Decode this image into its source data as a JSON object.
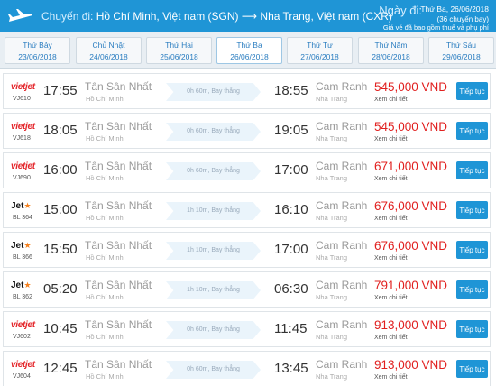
{
  "header": {
    "route_label": "Chuyến đi:",
    "route": "Hồ Chí Minh, Việt nam (SGN) ⟶ Nha Trang, Việt nam (CXR)",
    "date_label": "Ngày đi:",
    "date_text": "Thứ Ba, 26/06/2018",
    "flight_count": "(36 chuyến bay)",
    "price_note": "Giá vé đã bao gồm thuế và phụ phí"
  },
  "tabs": [
    {
      "day": "Thứ Bảy",
      "date": "23/06/2018"
    },
    {
      "day": "Chủ Nhật",
      "date": "24/06/2018"
    },
    {
      "day": "Thứ Hai",
      "date": "25/06/2018"
    },
    {
      "day": "Thứ Ba",
      "date": "26/06/2018"
    },
    {
      "day": "Thứ Tư",
      "date": "27/06/2018"
    },
    {
      "day": "Thứ Năm",
      "date": "28/06/2018"
    },
    {
      "day": "Thứ Sáu",
      "date": "29/06/2018"
    }
  ],
  "active_tab": "Thứ Ba",
  "flights": [
    {
      "airline": "vietjet",
      "logo_text": "vietjet",
      "flight_no": "VJ610",
      "dep_time": "17:55",
      "dep_airport": "Tân Sân Nhất",
      "dep_city": "Hồ Chí Minh",
      "duration": "0h 60m, Bay thẳng",
      "arr_time": "18:55",
      "arr_airport": "Cam Ranh",
      "arr_city": "Nha Trang",
      "price": "545,000 VND",
      "detail": "Xem chi tiết",
      "button": "Tiếp tục"
    },
    {
      "airline": "vietjet",
      "logo_text": "vietjet",
      "flight_no": "VJ618",
      "dep_time": "18:05",
      "dep_airport": "Tân Sân Nhất",
      "dep_city": "Hồ Chí Minh",
      "duration": "0h 60m, Bay thẳng",
      "arr_time": "19:05",
      "arr_airport": "Cam Ranh",
      "arr_city": "Nha Trang",
      "price": "545,000 VND",
      "detail": "Xem chi tiết",
      "button": "Tiếp tục"
    },
    {
      "airline": "vietjet",
      "logo_text": "vietjet",
      "flight_no": "VJ690",
      "dep_time": "16:00",
      "dep_airport": "Tân Sân Nhất",
      "dep_city": "Hồ Chí Minh",
      "duration": "0h 60m, Bay thẳng",
      "arr_time": "17:00",
      "arr_airport": "Cam Ranh",
      "arr_city": "Nha Trang",
      "price": "671,000 VND",
      "detail": "Xem chi tiết",
      "button": "Tiếp tục"
    },
    {
      "airline": "jetstar",
      "logo_text": "Jet",
      "flight_no": "BL 364",
      "dep_time": "15:00",
      "dep_airport": "Tân Sân Nhất",
      "dep_city": "Hồ Chí Minh",
      "duration": "1h 10m, Bay thẳng",
      "arr_time": "16:10",
      "arr_airport": "Cam Ranh",
      "arr_city": "Nha Trang",
      "price": "676,000 VND",
      "detail": "Xem chi tiết",
      "button": "Tiếp tục"
    },
    {
      "airline": "jetstar",
      "logo_text": "Jet",
      "flight_no": "BL 366",
      "dep_time": "15:50",
      "dep_airport": "Tân Sân Nhất",
      "dep_city": "Hồ Chí Minh",
      "duration": "1h 10m, Bay thẳng",
      "arr_time": "17:00",
      "arr_airport": "Cam Ranh",
      "arr_city": "Nha Trang",
      "price": "676,000 VND",
      "detail": "Xem chi tiết",
      "button": "Tiếp tục"
    },
    {
      "airline": "jetstar",
      "logo_text": "Jet",
      "flight_no": "BL 362",
      "dep_time": "05:20",
      "dep_airport": "Tân Sân Nhất",
      "dep_city": "Hồ Chí Minh",
      "duration": "1h 10m, Bay thẳng",
      "arr_time": "06:30",
      "arr_airport": "Cam Ranh",
      "arr_city": "Nha Trang",
      "price": "791,000 VND",
      "detail": "Xem chi tiết",
      "button": "Tiếp tục"
    },
    {
      "airline": "vietjet",
      "logo_text": "vietjet",
      "flight_no": "VJ602",
      "dep_time": "10:45",
      "dep_airport": "Tân Sân Nhất",
      "dep_city": "Hồ Chí Minh",
      "duration": "0h 60m, Bay thẳng",
      "arr_time": "11:45",
      "arr_airport": "Cam Ranh",
      "arr_city": "Nha Trang",
      "price": "913,000 VND",
      "detail": "Xem chi tiết",
      "button": "Tiếp tục"
    },
    {
      "airline": "vietjet",
      "logo_text": "vietjet",
      "flight_no": "VJ604",
      "dep_time": "12:45",
      "dep_airport": "Tân Sân Nhất",
      "dep_city": "Hồ Chí Minh",
      "duration": "0h 60m, Bay thẳng",
      "arr_time": "13:45",
      "arr_airport": "Cam Ranh",
      "arr_city": "Nha Trang",
      "price": "913,000 VND",
      "detail": "Xem chi tiết",
      "button": "Tiếp tục"
    }
  ],
  "colors": {
    "header": "#1f95d6",
    "price": "#e1201f",
    "button": "#1f95d6",
    "vietjet": "#e4262b",
    "jetstar_star": "#f58220"
  },
  "icons": {
    "header": "plane-icon",
    "jetstar": "star-icon"
  }
}
